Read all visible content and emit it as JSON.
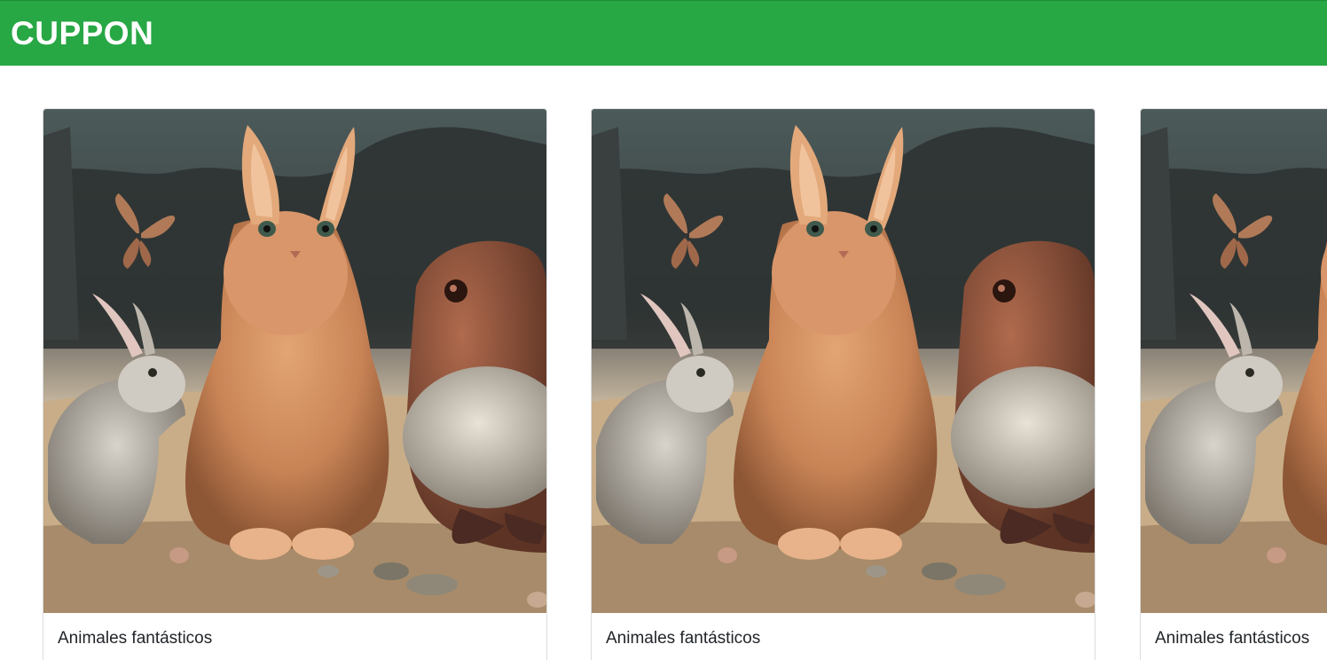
{
  "header": {
    "brand": "CUPPON",
    "background_color": "#28a745"
  },
  "cards": [
    {
      "title": "Animales fantásticos",
      "image_icon": "fantasy-animals-image"
    },
    {
      "title": "Animales fantásticos",
      "image_icon": "fantasy-animals-image"
    },
    {
      "title": "Animales fantásticos",
      "image_icon": "fantasy-animals-image"
    }
  ]
}
